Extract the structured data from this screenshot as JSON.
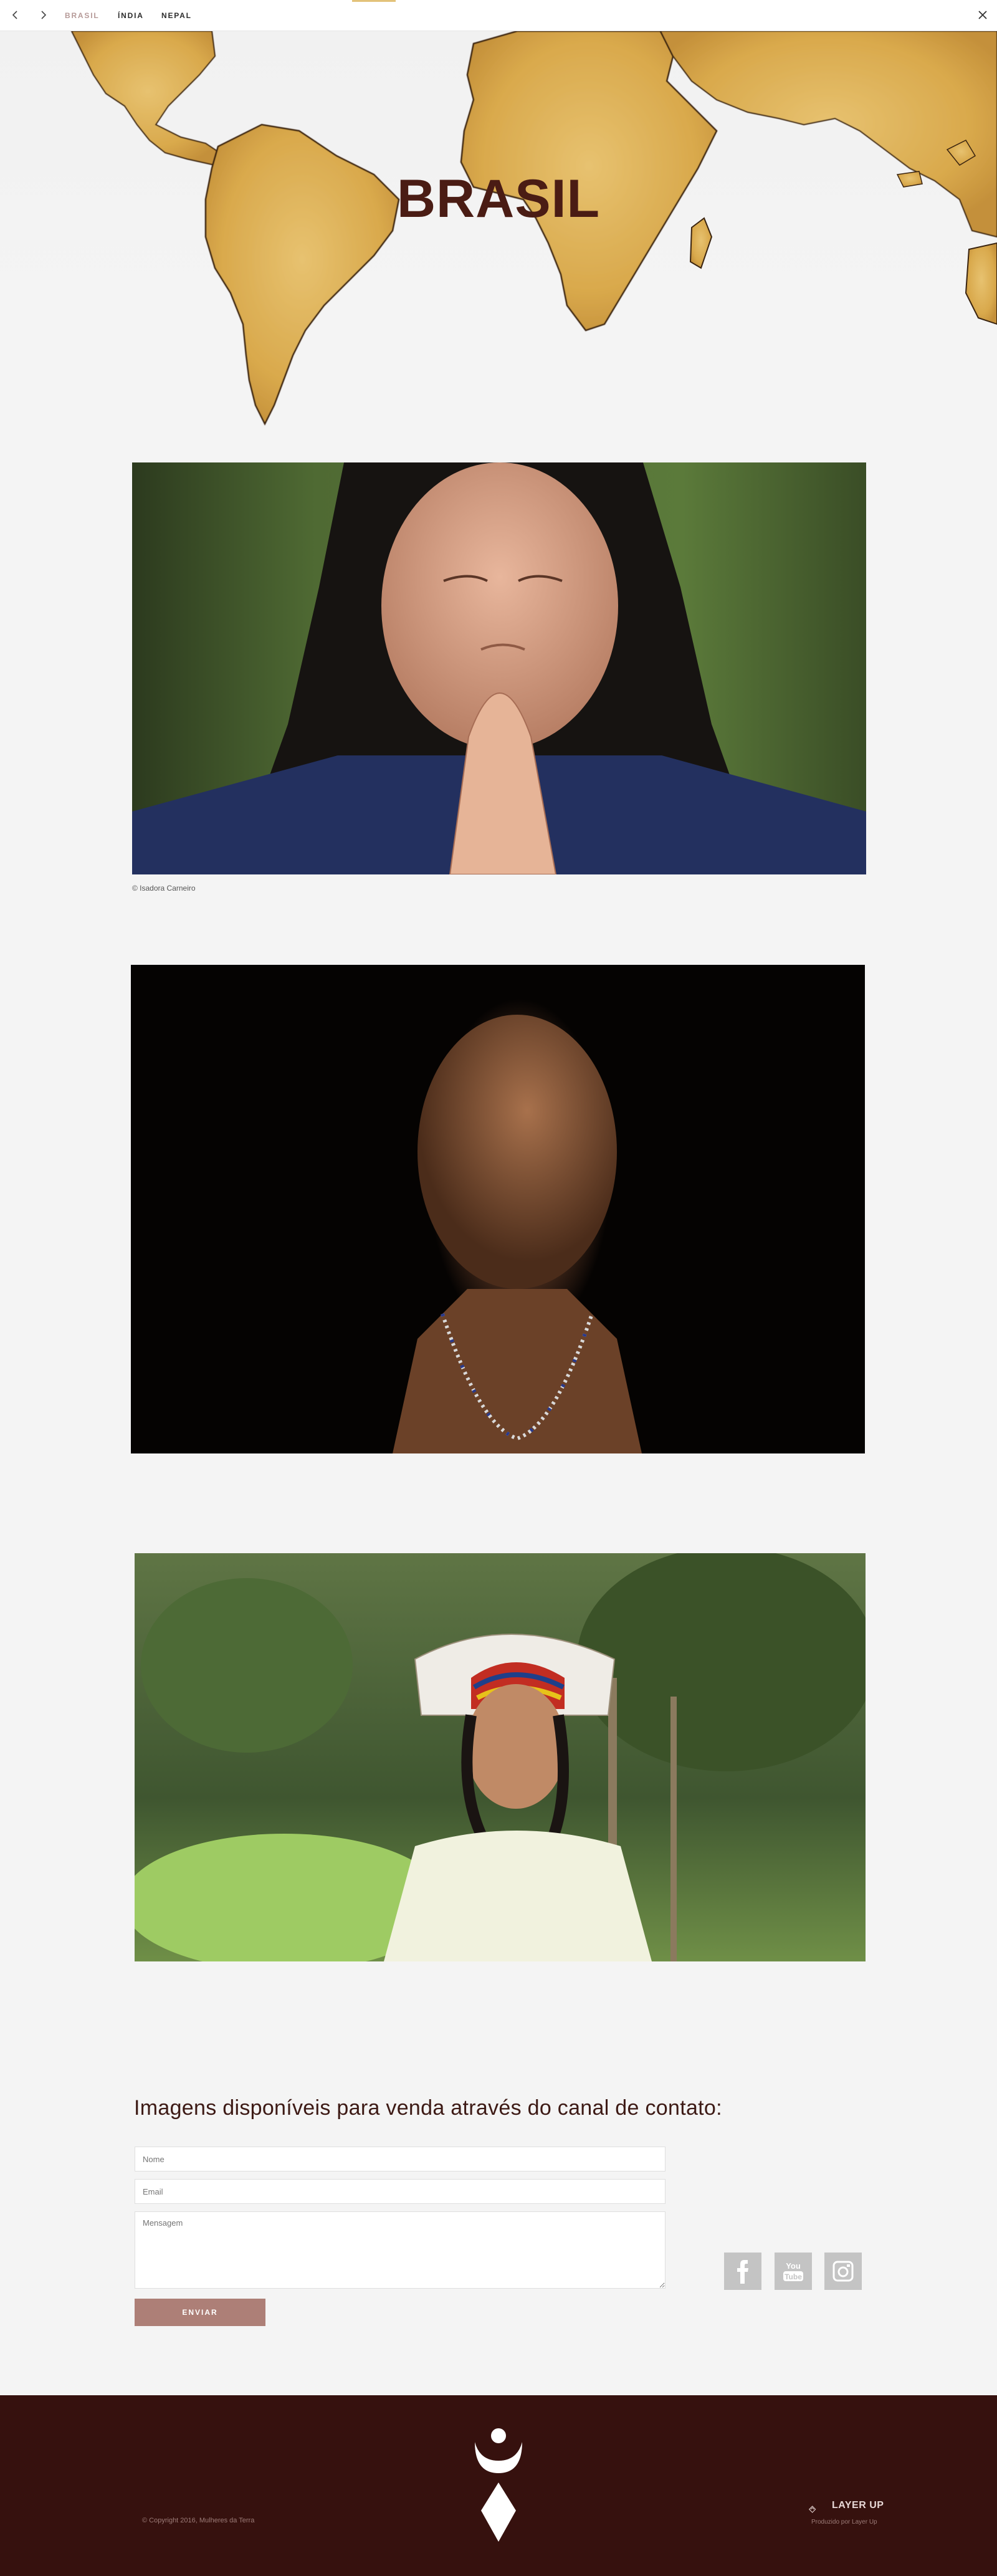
{
  "nav": {
    "tabs": [
      {
        "label": "BRASIL",
        "active": true
      },
      {
        "label": "ÍNDIA",
        "active": false
      },
      {
        "label": "NEPAL",
        "active": false
      }
    ],
    "prev_icon": "chevron-left-icon",
    "next_icon": "chevron-right-icon",
    "close_icon": "close-icon",
    "accent_color": "#e3c27a",
    "active_tab_color": "#b69a98"
  },
  "hero": {
    "title": "BRASIL",
    "title_color": "#4a1c14",
    "map_color": "#dcae52"
  },
  "photos": [
    {
      "credit": "© Isadora Carneiro"
    }
  ],
  "contact": {
    "title": "Imagens  disponíveis para venda através do canal de contato:",
    "name_placeholder": "Nome",
    "email_placeholder": "Email",
    "message_placeholder": "Mensagem",
    "send_label": "ENVIAR",
    "button_color": "#ad7f77"
  },
  "social": [
    {
      "icon": "facebook-icon"
    },
    {
      "icon": "youtube-icon"
    },
    {
      "icon": "instagram-icon"
    }
  ],
  "footer": {
    "copyright": "© Copyright 2016, Mulheres da Terra",
    "logo_text": "LAYER UP",
    "produced_by": "Produzido por Layer Up",
    "background": "#36110e"
  }
}
